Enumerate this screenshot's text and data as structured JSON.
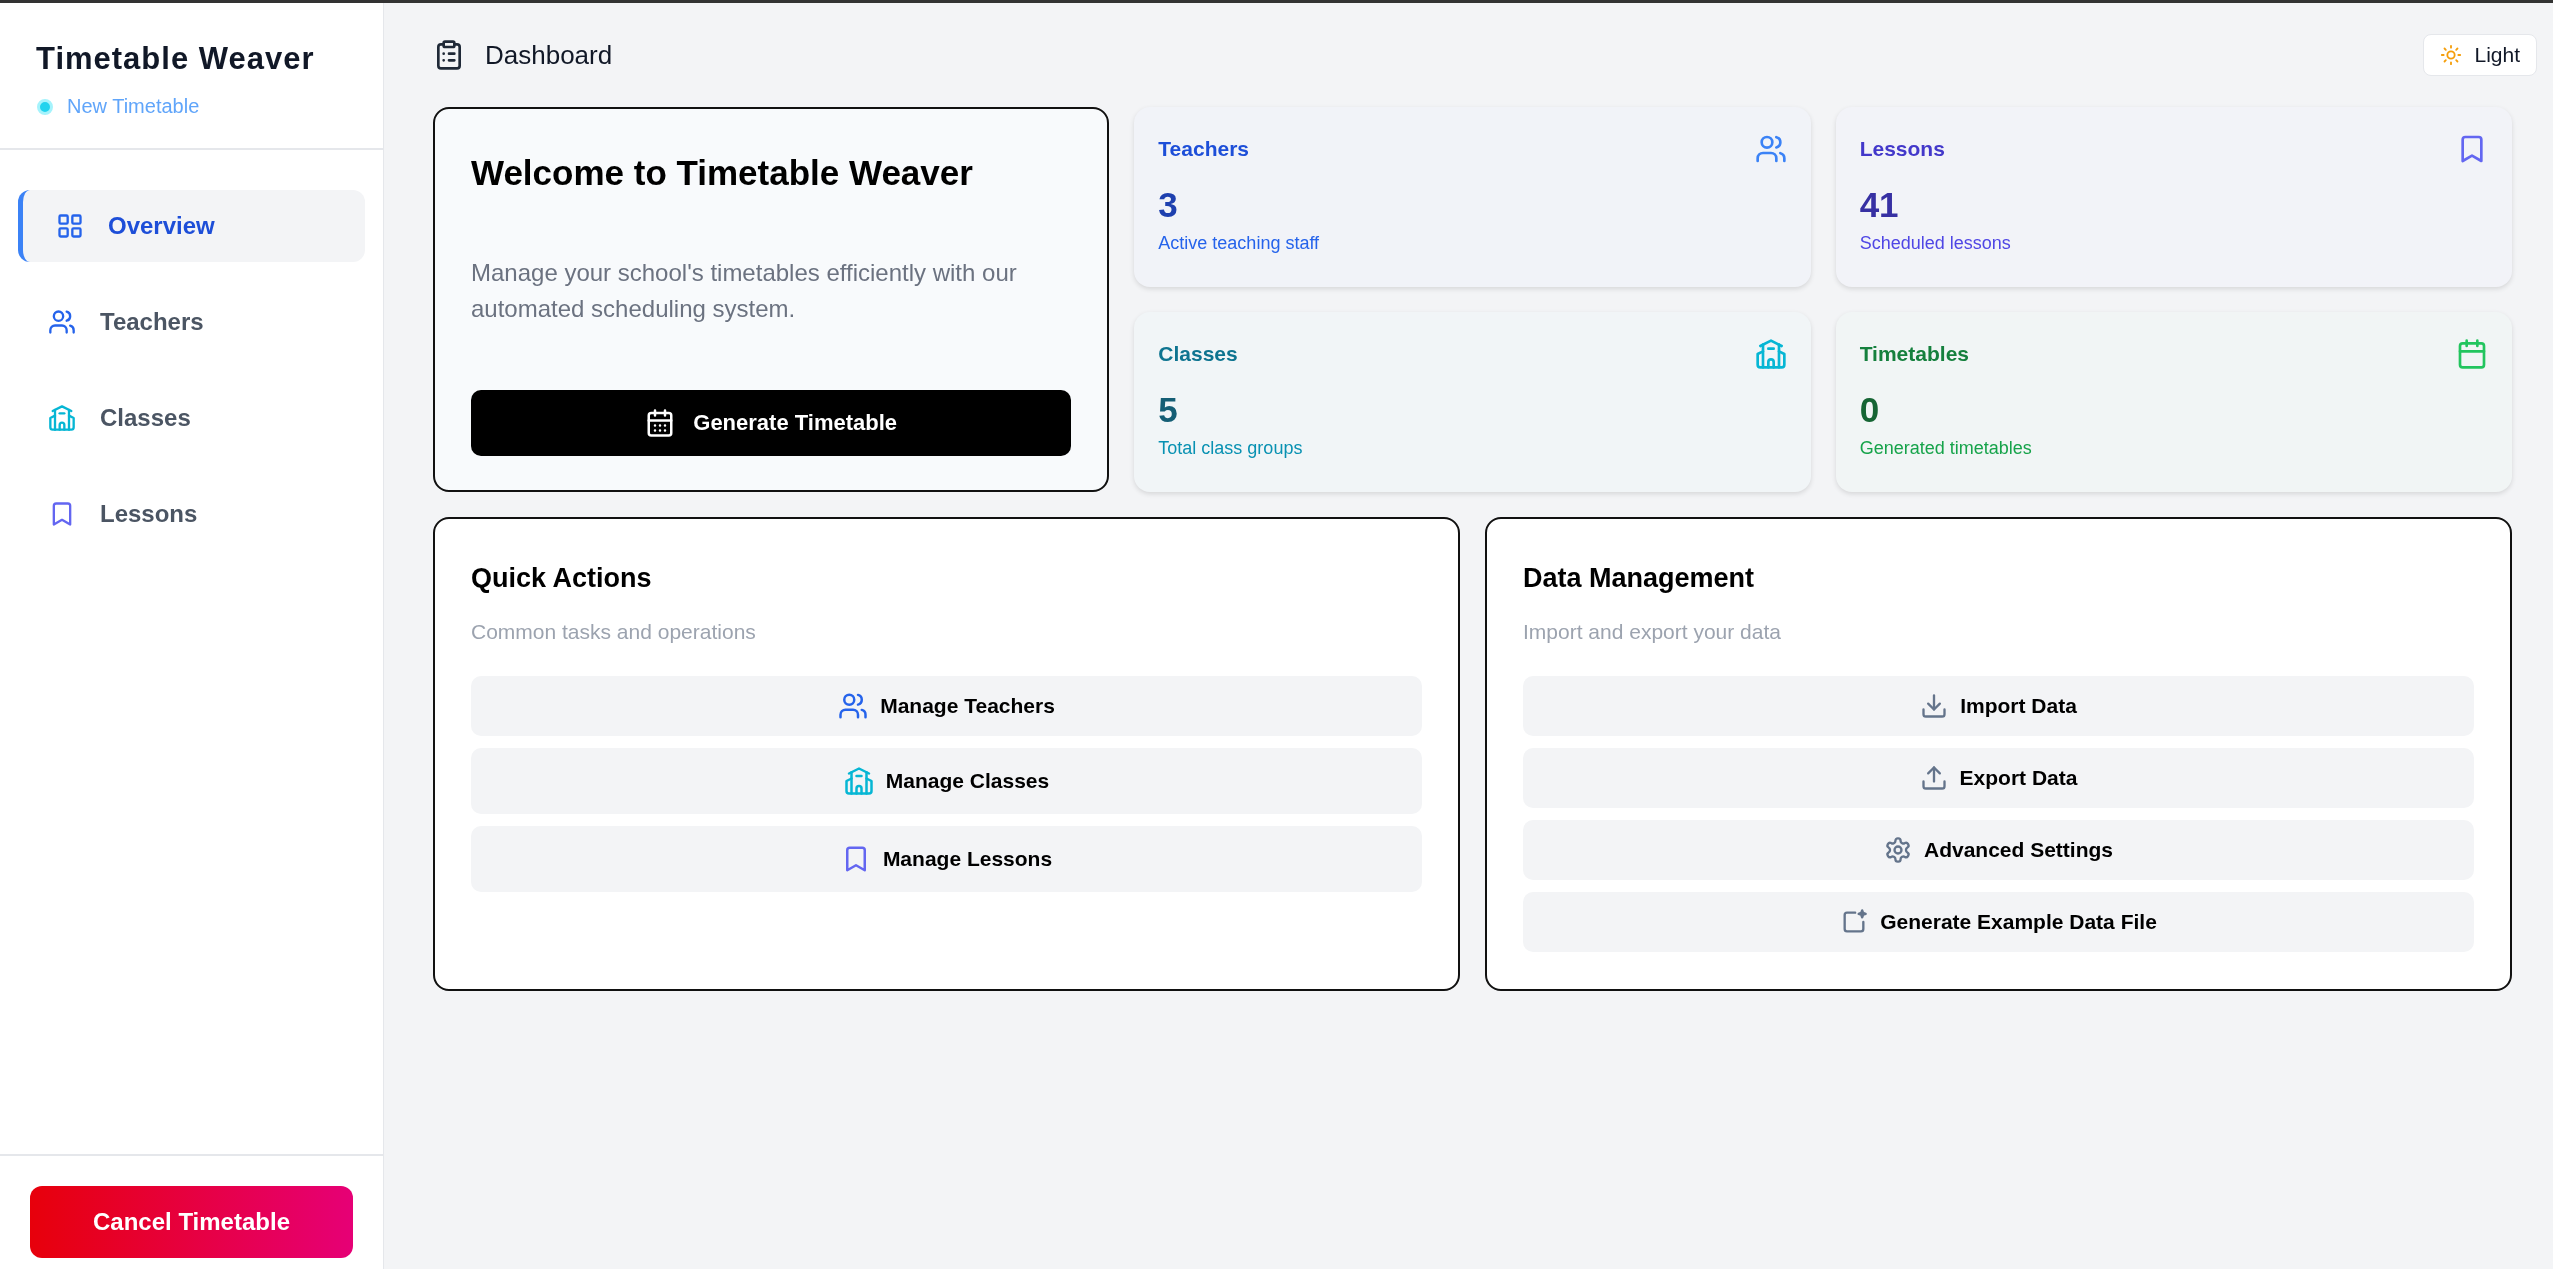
{
  "sidebar": {
    "app_title": "Timetable Weaver",
    "status": "New Timetable",
    "nav_items": [
      {
        "label": "Overview",
        "selected": true
      },
      {
        "label": "Teachers",
        "selected": false
      },
      {
        "label": "Classes",
        "selected": false
      },
      {
        "label": "Lessons",
        "selected": false
      }
    ],
    "cancel_button": "Cancel Timetable"
  },
  "header": {
    "title": "Dashboard",
    "theme_button": "Light"
  },
  "welcome": {
    "title": "Welcome to Timetable Weaver",
    "text": "Manage your school's timetables efficiently with our automated scheduling system.",
    "button": "Generate Timetable"
  },
  "stats": [
    {
      "title": "Teachers",
      "value": "3",
      "caption": "Active teaching staff"
    },
    {
      "title": "Lessons",
      "value": "41",
      "caption": "Scheduled lessons"
    },
    {
      "title": "Classes",
      "value": "5",
      "caption": "Total class groups"
    },
    {
      "title": "Timetables",
      "value": "0",
      "caption": "Generated timetables"
    }
  ],
  "quick_actions": {
    "title": "Quick Actions",
    "subtitle": "Common tasks and operations",
    "buttons": [
      "Manage Teachers",
      "Manage Classes",
      "Manage Lessons"
    ]
  },
  "data_management": {
    "title": "Data Management",
    "subtitle": "Import and export your data",
    "buttons": [
      "Import Data",
      "Export Data",
      "Advanced Settings",
      "Generate Example Data File"
    ]
  }
}
